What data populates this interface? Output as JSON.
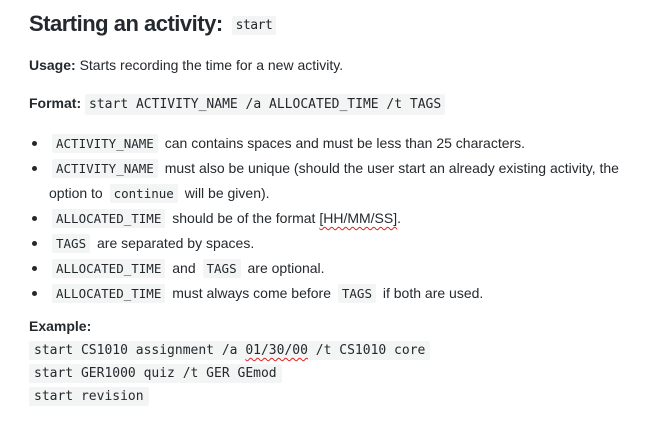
{
  "heading": {
    "title": "Starting an activity:",
    "command": "start"
  },
  "usage": {
    "label": "Usage:",
    "text": "Starts recording the time for a new activity."
  },
  "format": {
    "label": "Format:",
    "code": "start ACTIVITY_NAME /a ALLOCATED_TIME /t TAGS"
  },
  "bullets": {
    "b1": {
      "code1": "ACTIVITY_NAME",
      "text1": "can contains spaces and must be less than 25 characters."
    },
    "b2": {
      "code1": "ACTIVITY_NAME",
      "text1": "must also be unique (should the user start an already existing activity, the option to",
      "code2": "continue",
      "text2": "will be given)."
    },
    "b3": {
      "code1": "ALLOCATED_TIME",
      "text1": "should be of the format",
      "underlined": "[HH/MM/SS]",
      "text2": "."
    },
    "b4": {
      "code1": "TAGS",
      "text1": "are separated by spaces."
    },
    "b5": {
      "code1": "ALLOCATED_TIME",
      "text1": "and",
      "code2": "TAGS",
      "text2": "are optional."
    },
    "b6": {
      "code1": "ALLOCATED_TIME",
      "text1": "must always come before",
      "code2": "TAGS",
      "text2": "if both are used."
    }
  },
  "example": {
    "label": "Example:",
    "line1": {
      "before": "start CS1010 assignment /a ",
      "underlined": "01/30/00",
      "after": " /t CS1010 core"
    },
    "line2": "start GER1000 quiz /t GER GEmod",
    "line3": "start revision"
  }
}
